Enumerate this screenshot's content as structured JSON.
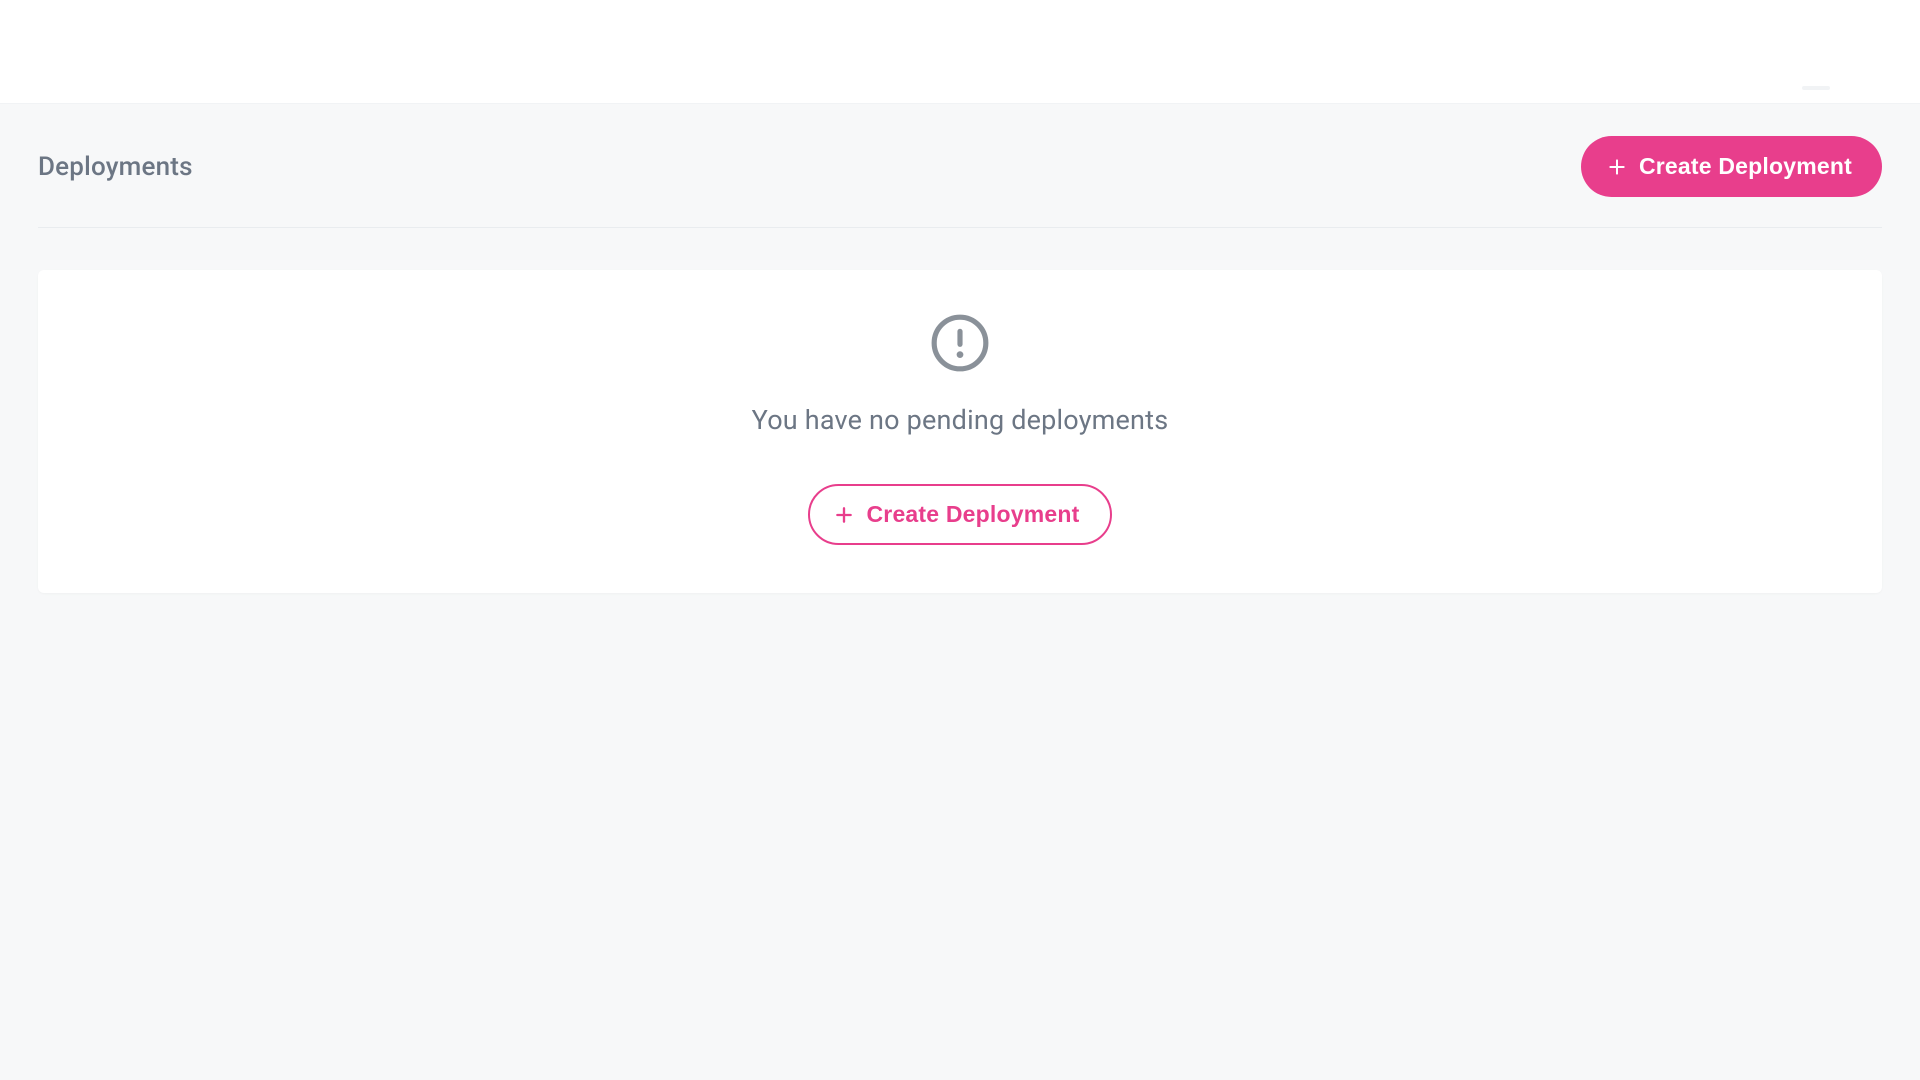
{
  "page": {
    "title": "Deployments"
  },
  "header": {
    "create_button_label": "Create Deployment"
  },
  "empty_state": {
    "message": "You have no pending deployments",
    "create_button_label": "Create Deployment"
  },
  "icons": {
    "plus": "plus-icon",
    "alert_circle": "alert-circle-icon"
  },
  "colors": {
    "accent": "#e83e8c",
    "text_muted": "#6c7684",
    "icon_muted": "#8a9199",
    "page_bg": "#f7f8f9"
  }
}
